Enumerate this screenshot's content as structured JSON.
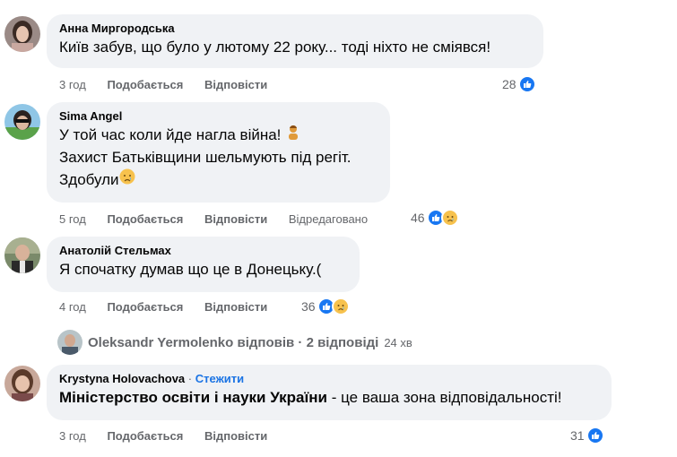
{
  "comments": [
    {
      "author": "Анна Миргородська",
      "lines": [
        "Київ забув, що було у лютому 22 року... тоді ніхто не сміявся!"
      ],
      "time": "3 год",
      "like_label": "Подобається",
      "reply_label": "Відповісти",
      "reaction_count": "28"
    },
    {
      "author": "Sima Angel",
      "lines": [
        "У той час коли йде нагла війна!",
        "Захист Батьківщини шельмують під регіт.",
        "Здобули"
      ],
      "time": "5 год",
      "like_label": "Подобається",
      "reply_label": "Відповісти",
      "edited_label": "Відредаговано",
      "reaction_count": "46"
    },
    {
      "author": "Анатолій Стельмах",
      "lines": [
        "Я спочатку думав що це в Донецьку.("
      ],
      "time": "4 год",
      "like_label": "Подобається",
      "reply_label": "Відповісти",
      "reaction_count": "36"
    },
    {
      "author": "Krystyna Holovachova",
      "follow_label": "Стежити",
      "text_bold": "Міністерство освіти і науки України",
      "text_rest": " - це ваша зона відповідальності!",
      "time": "3 год",
      "like_label": "Подобається",
      "reply_label": "Відповісти",
      "reaction_count": "31"
    }
  ],
  "replies_row": {
    "name": "Oleksandr Yermolenko",
    "action": "відповів",
    "count": "2 відповіді",
    "time": "24 хв"
  },
  "icons": {
    "like": "like-reaction-icon",
    "sad": "sad-reaction-icon",
    "emoji_person": "person-emoji-icon",
    "emoji_sad": "crying-face-emoji-icon"
  },
  "colors": {
    "bubble": "#f0f2f5",
    "like_blue": "#1877f2",
    "meta_gray": "#65676b",
    "follow_blue": "#1b74e4"
  }
}
